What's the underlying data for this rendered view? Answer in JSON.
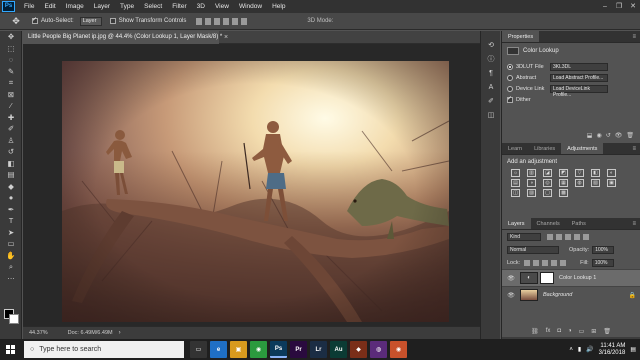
{
  "menubar": {
    "logo": "Ps",
    "items": [
      "File",
      "Edit",
      "Image",
      "Layer",
      "Type",
      "Select",
      "Filter",
      "3D",
      "View",
      "Window",
      "Help"
    ]
  },
  "options": {
    "auto_select_label": "Auto-Select:",
    "auto_select_value": "Layer",
    "transform_label": "Show Transform Controls",
    "mode_3d_label": "3D Mode:"
  },
  "document": {
    "tab_title": "Little People Big Planet ip.jpg @ 44.4% (Color Lookup 1, Layer Mask/8) *",
    "close_glyph": "×"
  },
  "status": {
    "zoom": "44.37%",
    "doc_info": "Doc: 6.49M/6.49M",
    "arrow": "›"
  },
  "properties": {
    "tabs": [
      "Properties"
    ],
    "title": "Color Lookup",
    "rows": [
      {
        "label": "3DLUT File",
        "value": "3KL3DL",
        "selected": true
      },
      {
        "label": "Abstract",
        "value": "Load Abstract Profile...",
        "selected": false
      },
      {
        "label": "Device Link",
        "value": "Load DeviceLink Profile...",
        "selected": false
      }
    ],
    "dither_label": "Dither"
  },
  "adjustments": {
    "tabs": [
      "Learn",
      "Libraries",
      "Adjustments"
    ],
    "active_tab": "Adjustments",
    "title": "Add an adjustment",
    "icons": [
      "☼",
      "▥",
      "◪",
      "◩",
      "▽",
      "◧",
      "◐",
      "▤",
      "◑",
      "◎",
      "▦",
      "◍",
      "▧",
      "▣",
      "◫",
      "▨",
      "▢",
      "▩"
    ]
  },
  "layers": {
    "tabs": [
      "Layers",
      "Channels",
      "Paths"
    ],
    "kind_label": "Kind",
    "blend_mode": "Normal",
    "opacity_label": "Opacity:",
    "opacity_value": "100%",
    "lock_label": "Lock:",
    "fill_label": "Fill:",
    "fill_value": "100%",
    "items": [
      {
        "name": "Color Lookup 1",
        "selected": true
      },
      {
        "name": "Background",
        "selected": false
      }
    ]
  },
  "taskbar": {
    "search_placeholder": "Type here to search",
    "time": "11:41 AM",
    "date": "3/16/2018",
    "apps": [
      {
        "label": "▭",
        "color": "#333333"
      },
      {
        "label": "e",
        "color": "#1f6fc5"
      },
      {
        "label": "▣",
        "color": "#d89a1e"
      },
      {
        "label": "◉",
        "color": "#2b9a3e"
      },
      {
        "label": "Ps",
        "color": "#0b3a5b"
      },
      {
        "label": "Pr",
        "color": "#2a0a3e"
      },
      {
        "label": "Lr",
        "color": "#1b2d44"
      },
      {
        "label": "Au",
        "color": "#0b3b34"
      },
      {
        "label": "◆",
        "color": "#7a2e18"
      },
      {
        "label": "◍",
        "color": "#5b2b7a"
      },
      {
        "label": "◉",
        "color": "#c8512b"
      }
    ]
  },
  "colors": {
    "accent": "#31a8ff",
    "panel_bg": "#535353",
    "chrome_dark": "#323232"
  }
}
